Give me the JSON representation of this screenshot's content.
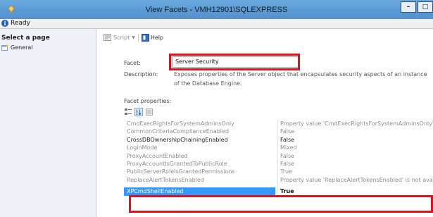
{
  "window": {
    "title": "View Facets - VMH12901\\SQLEXPRESS",
    "min_label": "–",
    "max_label": "□"
  },
  "status": {
    "text": "Ready"
  },
  "left_pane": {
    "header": "Select a page",
    "items": [
      {
        "label": "General",
        "icon": "page-icon"
      }
    ]
  },
  "toolbar": {
    "script_label": "Script",
    "help_label": "Help"
  },
  "facet": {
    "label": "Facet:",
    "value": "Server Security"
  },
  "description": {
    "label": "Description:",
    "text": "Exposes properties of the Server object that encapsulates security aspects of an instance of the Database Engine."
  },
  "properties_label": "Facet properties:",
  "properties": [
    {
      "name": "CmdExecRightsForSystemAdminsOnly",
      "value": "Property value 'CmdExecRightsForSystemAdminsOnly' i",
      "state": "disabled"
    },
    {
      "name": "CommonCriteriaComplianceEnabled",
      "value": "False",
      "state": "disabled"
    },
    {
      "name": "CrossDBOwnershipChainingEnabled",
      "value": "False",
      "state": "enabled"
    },
    {
      "name": "LoginMode",
      "value": "Mixed",
      "state": "disabled"
    },
    {
      "name": "ProxyAccountEnabled",
      "value": "False",
      "state": "disabled"
    },
    {
      "name": "ProxyAccountIsGrantedToPublicRole",
      "value": "False",
      "state": "disabled"
    },
    {
      "name": "PublicServerRoleIsGrantedPermissions",
      "value": "True",
      "state": "disabled"
    },
    {
      "name": "ReplaceAlertTokensEnabled",
      "value": "Property value 'ReplaceAlertTokensEnabled' is not avail",
      "state": "disabled"
    },
    {
      "name": "XPCmdShellEnabled",
      "value": "True",
      "state": "selected"
    }
  ],
  "colors": {
    "highlight_red": "#e3101b",
    "selection_blue": "#3399ff",
    "title_blue": "#5b9bd5"
  }
}
